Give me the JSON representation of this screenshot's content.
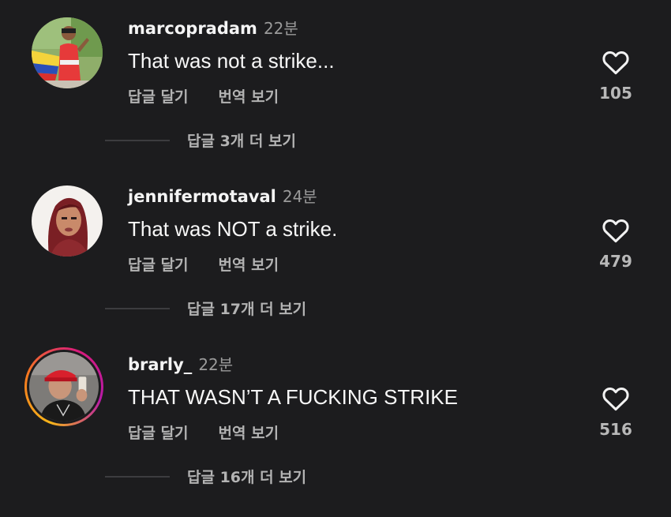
{
  "comments": [
    {
      "username": "marcopradam",
      "time": "22분",
      "text": "That was not a strike...",
      "reply_label": "답글 달기",
      "translate_label": "번역 보기",
      "likes": "105",
      "more_replies": "답글 3개 더 보기"
    },
    {
      "username": "jennifermotaval",
      "time": "24분",
      "text": "That was NOT a strike.",
      "reply_label": "답글 달기",
      "translate_label": "번역 보기",
      "likes": "479",
      "more_replies": "답글 17개 더 보기"
    },
    {
      "username": "brarly_",
      "time": "22분",
      "text": "THAT WASN’T A FUCKING STRIKE",
      "reply_label": "답글 달기",
      "translate_label": "번역 보기",
      "likes": "516",
      "more_replies": "답글 16개 더 보기"
    }
  ],
  "icons": {
    "like": "heart-outline-icon"
  },
  "colors": {
    "background": "#1c1c1e",
    "primary_text": "#f7f7f7",
    "secondary_text": "#b3b3b3",
    "story_ring": [
      "#f5b41a",
      "#f7771f",
      "#d81b7a",
      "#b81aa8"
    ]
  }
}
